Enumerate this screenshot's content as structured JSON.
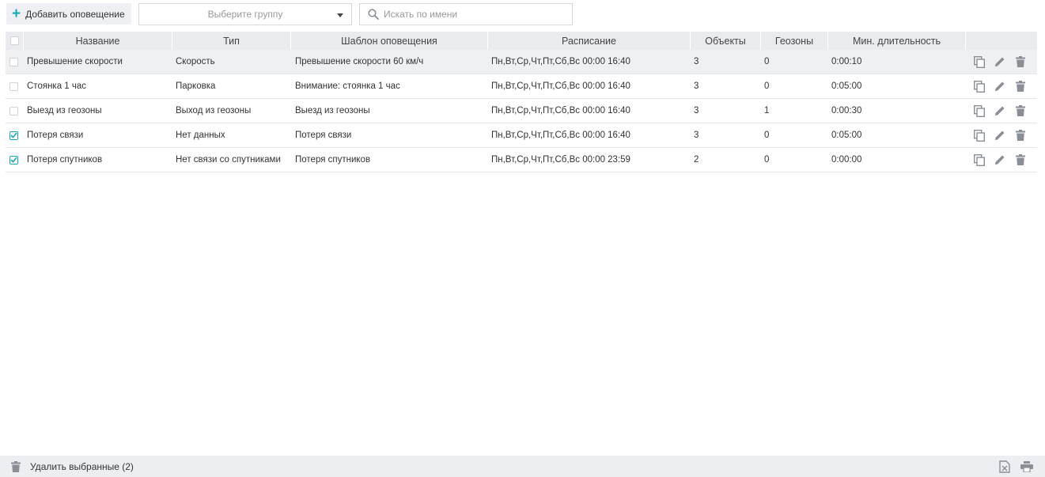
{
  "toolbar": {
    "add_label": "Добавить оповещение",
    "group_placeholder": "Выберите группу",
    "search_placeholder": "Искать по имени"
  },
  "table": {
    "columns": [
      "Название",
      "Тип",
      "Шаблон оповещения",
      "Расписание",
      "Объекты",
      "Геозоны",
      "Мин. длительность"
    ],
    "rows": [
      {
        "checked": false,
        "name": "Превышение скорости",
        "type": "Скорость",
        "template": "Превышение скорости 60 км/ч",
        "schedule": "Пн,Вт,Ср,Чт,Пт,Сб,Вс 00:00 16:40",
        "objects": "3",
        "geozones": "0",
        "min_duration": "0:00:10"
      },
      {
        "checked": false,
        "name": "Стоянка 1 час",
        "type": "Парковка",
        "template": "Внимание: стоянка 1 час",
        "schedule": "Пн,Вт,Ср,Чт,Пт,Сб,Вс 00:00 16:40",
        "objects": "3",
        "geozones": "0",
        "min_duration": "0:05:00"
      },
      {
        "checked": false,
        "name": "Выезд из геозоны",
        "type": "Выход из геозоны",
        "template": "Выезд из геозоны",
        "schedule": "Пн,Вт,Ср,Чт,Пт,Сб,Вс 00:00 16:40",
        "objects": "3",
        "geozones": "1",
        "min_duration": "0:00:30"
      },
      {
        "checked": true,
        "name": "Потеря связи",
        "type": "Нет данных",
        "template": "Потеря связи",
        "schedule": "Пн,Вт,Ср,Чт,Пт,Сб,Вс 00:00 16:40",
        "objects": "3",
        "geozones": "0",
        "min_duration": "0:05:00"
      },
      {
        "checked": true,
        "name": "Потеря спутников",
        "type": "Нет связи со спутниками",
        "template": "Потеря спутников",
        "schedule": "Пн,Вт,Ср,Чт,Пт,Сб,Вс 00:00 23:59",
        "objects": "2",
        "geozones": "0",
        "min_duration": "0:00:00"
      }
    ],
    "row_actions": [
      "copy-icon",
      "edit-icon",
      "delete-icon"
    ]
  },
  "footer": {
    "delete_selected_label": "Удалить выбранные (2)",
    "right_icons": [
      "excel-export-icon",
      "print-icon"
    ]
  },
  "colors": {
    "accent": "#1aa7b6",
    "header_bg": "#e9ebee",
    "footer_bg": "#eceef1",
    "icon_gray": "#8a8f96"
  }
}
